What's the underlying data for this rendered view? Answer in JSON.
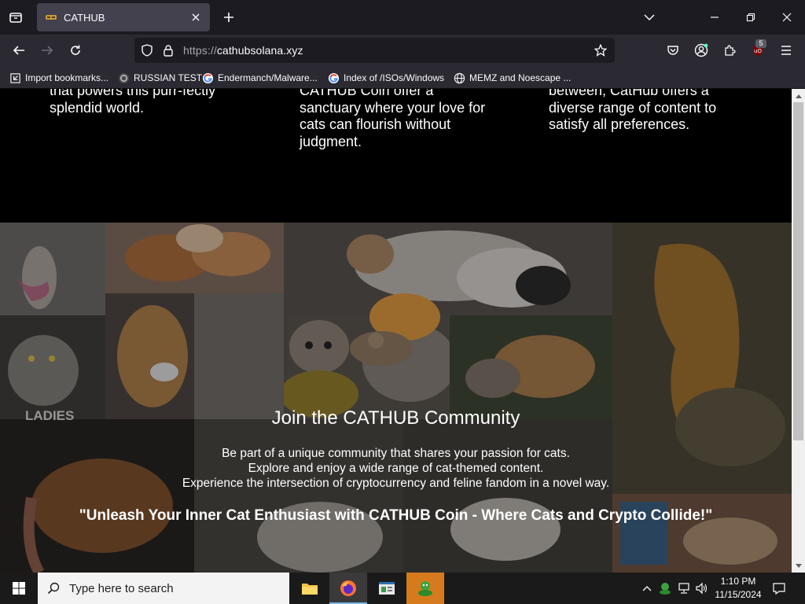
{
  "browser": {
    "tab_title": "CATHUB",
    "url_scheme": "https://",
    "url_host": "cathubsolana.xyz",
    "extension_badge": "5",
    "bookmarks": [
      {
        "label": "Import bookmarks...",
        "icon": "import-icon"
      },
      {
        "label": "RUSSIAN TEST",
        "icon": "site-icon"
      },
      {
        "label": "Endermanch/Malware...",
        "icon": "google-icon"
      },
      {
        "label": "Index of /ISOs/Windows",
        "icon": "google-icon"
      },
      {
        "label": "MEMZ and Noescape ...",
        "icon": "globe-icon"
      }
    ]
  },
  "features": {
    "col1": {
      "partial_line": "that powers this purr-fectly",
      "line2": "splendid world."
    },
    "col2": {
      "partial_line": "CATHUB Coin offer a",
      "line2": "sanctuary where your love for",
      "line3": "cats can flourish without",
      "line4": "judgment."
    },
    "col3": {
      "partial_line": "between, CatHub offers a",
      "line2": "diverse range of content to",
      "line3": "satisfy all preferences."
    }
  },
  "community": {
    "title": "Join the CATHUB Community",
    "line1": "Be part of a unique community that shares your passion for cats.",
    "line2": "Explore and enjoy a wide range of cat-themed content.",
    "line3": "Experience the intersection of cryptocurrency and feline fandom in a novel way.",
    "quote": "\"Unleash Your Inner Cat Enthusiast with CATHUB Coin - Where Cats and Crypto Collide!\"",
    "tile_text": "LADIES"
  },
  "taskbar": {
    "search_placeholder": "Type here to search",
    "time": "1:10 PM",
    "date": "11/15/2024"
  },
  "colors": {
    "tab_bg": "#42414d",
    "toolbar_bg": "#2b2a33",
    "taskbar_bg": "#1a1a1a",
    "accent": "#76b9ed"
  }
}
